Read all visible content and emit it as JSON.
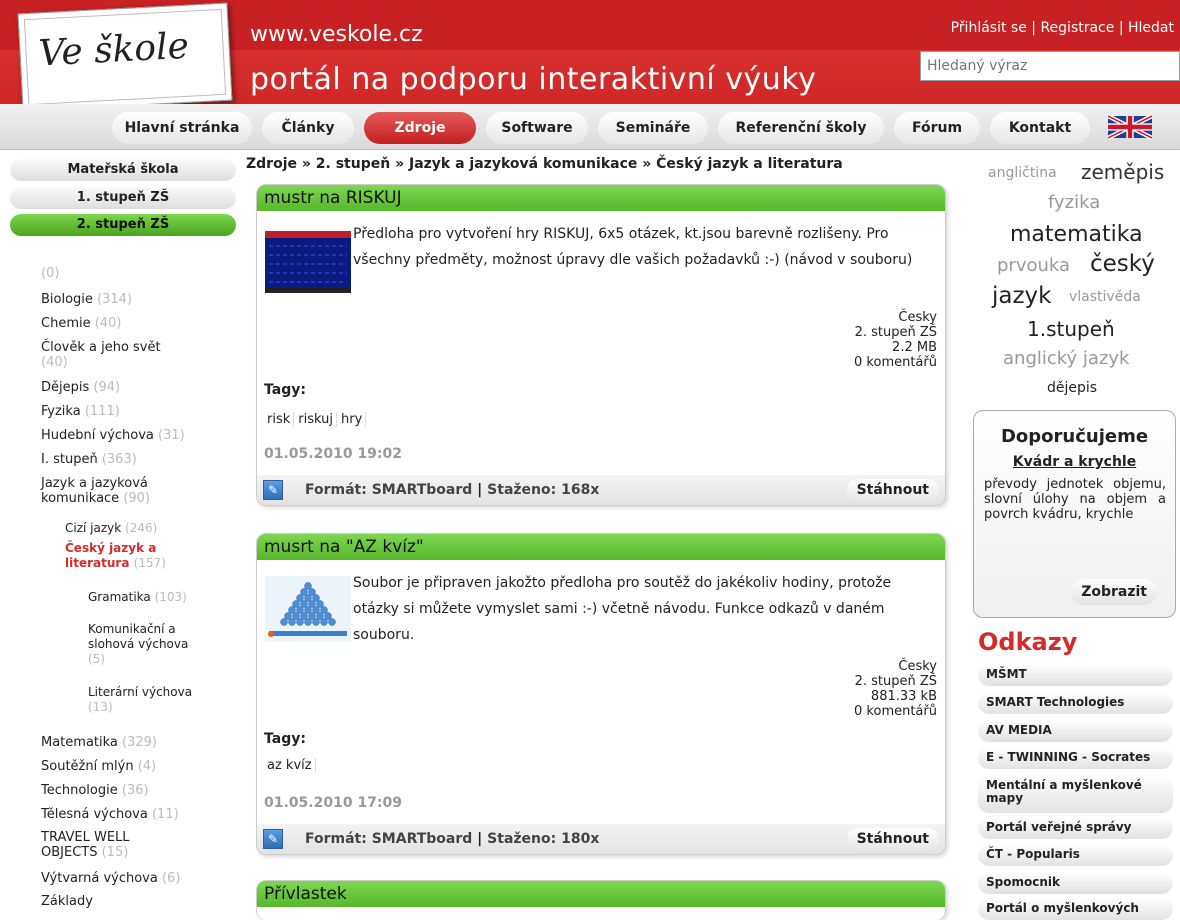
{
  "header": {
    "logo_text": "Ve škole",
    "url": "www.veskole.cz",
    "tagline": "portál na podporu interaktivní výuky",
    "top_links": [
      "Přihlásit se",
      "Registrace",
      "Hledat"
    ],
    "search_placeholder": "Hledaný výraz"
  },
  "nav": {
    "tabs": [
      "Hlavní stránka",
      "Články",
      "Zdroje",
      "Software",
      "Semináře",
      "Referenční školy",
      "Fórum",
      "Kontakt"
    ],
    "active": "Zdroje",
    "flag_icon": "uk-flag-icon"
  },
  "sidebar": {
    "levels": [
      "Mateřská škola",
      "1. stupeň ZŠ",
      "2. stupeň ZŠ"
    ],
    "active_level": "2. stupeň ZŠ",
    "categories": [
      {
        "name": "",
        "count": "(0)"
      },
      {
        "name": "Biologie",
        "count": "(314)"
      },
      {
        "name": "Chemie",
        "count": "(40)"
      },
      {
        "name": "Člověk a jeho svět",
        "count": "(40)"
      },
      {
        "name": "Dějepis",
        "count": "(94)"
      },
      {
        "name": "Fyzika",
        "count": "(111)"
      },
      {
        "name": "Hudební výchova",
        "count": "(31)"
      },
      {
        "name": "I. stupeň",
        "count": "(363)"
      },
      {
        "name": "Jazyk a jazyková komunikace",
        "count": "(90)"
      },
      {
        "name": "Cizí jazyk",
        "count": "(246)"
      },
      {
        "name": "Český jazyk a literatura",
        "count": "(157)"
      },
      {
        "name": "Gramatika",
        "count": "(103)"
      },
      {
        "name": "Komunikační a slohová výchova",
        "count": "(5)"
      },
      {
        "name": "Literární výchova",
        "count": "(13)"
      },
      {
        "name": "Matematika",
        "count": "(329)"
      },
      {
        "name": "Soutěžní mlýn",
        "count": "(4)"
      },
      {
        "name": "Technologie",
        "count": "(36)"
      },
      {
        "name": "Tělesná výchova",
        "count": "(11)"
      },
      {
        "name": "TRAVEL WELL OBJECTS",
        "count": "(15)"
      },
      {
        "name": "Výtvarná výchova",
        "count": "(6)"
      },
      {
        "name": "Základy",
        "count": ""
      }
    ]
  },
  "breadcrumb": "Zdroje » 2. stupeň » Jazyk a jazyková komunikace » Český jazyk a literatura",
  "resources": [
    {
      "title": "mustr na RISKUJ",
      "description": "Předloha pro vytvoření hry RISKUJ, 6x5 otázek, kt.jsou barevně rozlišeny. Pro všechny předměty, možnost úpravy dle vašich požadavků :-) (návod v souboru)",
      "language": "Česky",
      "level": "2. stupeň ZŠ",
      "size": "2.2 MB",
      "comments": "0 komentářů",
      "tags_label": "Tagy:",
      "tags": [
        "risk",
        "riskuj",
        "hry"
      ],
      "date": "01.05.2010 19:02",
      "format": "Formát: SMARTboard",
      "downloads": "Staženo: 168x",
      "download_label": "Stáhnout"
    },
    {
      "title": "musrt na \"AZ kvíz\"",
      "description": "Soubor je připraven jakožto předloha pro soutěž do jakékoliv hodiny, protože otázky si můžete vymyslet sami :-) včetně návodu. Funkce odkazů v daném souboru.",
      "language": "Česky",
      "level": "2. stupeň ZŠ",
      "size": "881.33 kB",
      "comments": "0 komentářů",
      "tags_label": "Tagy:",
      "tags": [
        "az kvíz"
      ],
      "date": "01.05.2010 17:09",
      "format": "Formát: SMARTboard",
      "downloads": "Staženo: 180x",
      "download_label": "Stáhnout"
    },
    {
      "title": "Přívlastek"
    }
  ],
  "tagcloud": [
    "angličtina",
    "zeměpis",
    "fyzika",
    "matematika",
    "prvouka",
    "český",
    "jazyk",
    "vlastivěda",
    "1.stupeň",
    "anglický jazyk",
    "dějepis"
  ],
  "recommend": {
    "heading": "Doporučujeme",
    "link": "Kvádr a krychle",
    "text": "převody jednotek objemu, slovní úlohy na objem a povrch kvádru, krychle",
    "button": "Zobrazit"
  },
  "links": {
    "heading": "Odkazy",
    "items": [
      "MŠMT",
      "SMART Technologies",
      "AV MEDIA",
      "E - TWINNING - Socrates",
      "Mentální a myšlenkové mapy",
      "Portál veřejné správy",
      "ČT - Popularis",
      "Spomocnik",
      "Portál o myšlenkových"
    ]
  },
  "colors": {
    "brand_red": "#d42b2c",
    "accent_green": "#5cbc2d"
  }
}
